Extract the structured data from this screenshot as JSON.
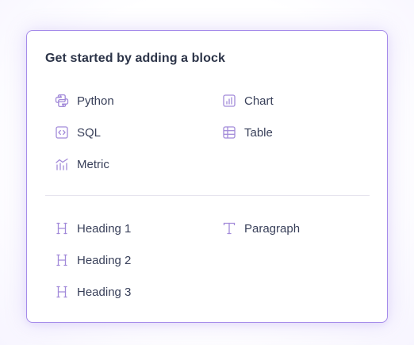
{
  "title": "Get started by adding a block",
  "code_blocks": [
    {
      "label": "Python",
      "icon": "python-icon"
    },
    {
      "label": "Chart",
      "icon": "chart-icon"
    },
    {
      "label": "SQL",
      "icon": "sql-icon"
    },
    {
      "label": "Table",
      "icon": "table-icon"
    },
    {
      "label": "Metric",
      "icon": "metric-icon"
    }
  ],
  "text_blocks": [
    {
      "label": "Heading 1",
      "icon": "heading-icon"
    },
    {
      "label": "Paragraph",
      "icon": "paragraph-icon"
    },
    {
      "label": "Heading 2",
      "icon": "heading-icon"
    },
    {
      "label": "Heading 3",
      "icon": "heading-icon"
    }
  ],
  "colors": {
    "accent": "#a58bea",
    "icon": "#a28ad9",
    "text": "#39405a",
    "title": "#2c3448"
  }
}
